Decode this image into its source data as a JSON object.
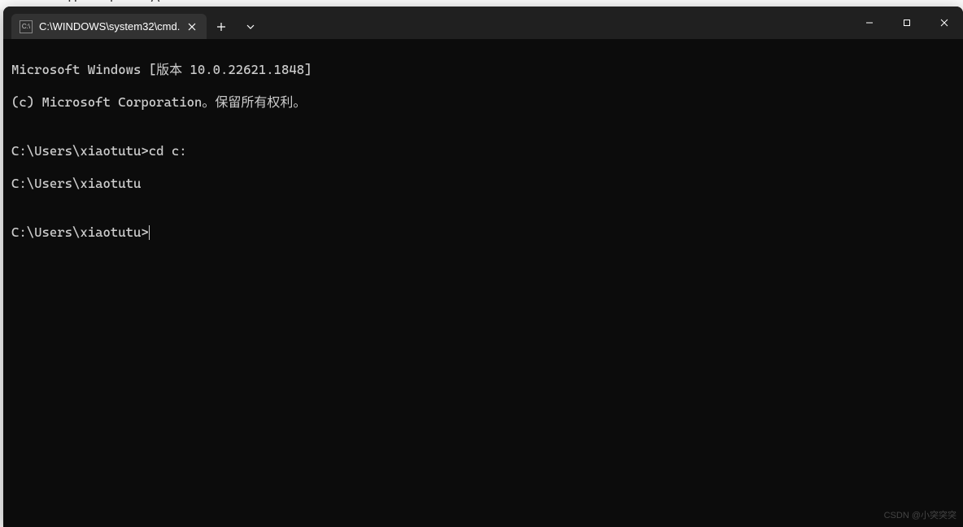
{
  "tab": {
    "title": "C:\\WINDOWS\\system32\\cmd."
  },
  "terminal": {
    "line1": "Microsoft Windows [版本 10.0.22621.1848]",
    "line2": "(c) Microsoft Corporation。保留所有权利。",
    "blank1": "",
    "line3": "C:\\Users\\xiaotutu>cd c:",
    "line4": "C:\\Users\\xiaotutu",
    "blank2": "",
    "prompt": "C:\\Users\\xiaotutu>"
  },
  "watermark": "CSDN @小突突突"
}
